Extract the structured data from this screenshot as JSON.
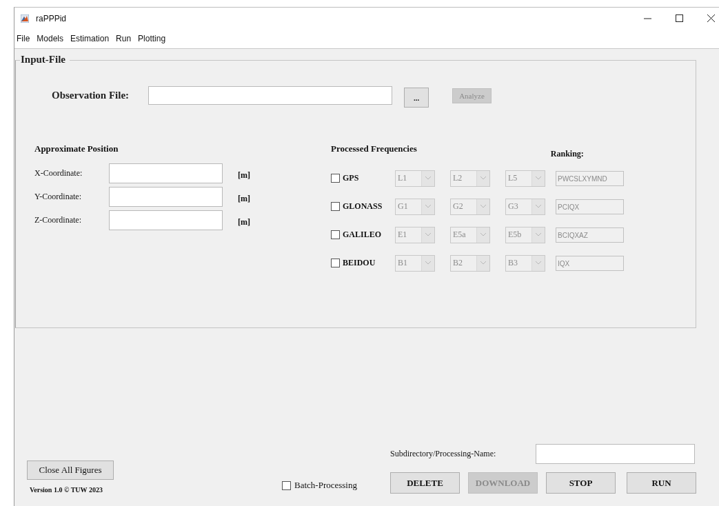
{
  "window": {
    "title": "raPPPid"
  },
  "menu": [
    "File",
    "Models",
    "Estimation",
    "Run",
    "Plotting"
  ],
  "input_panel": {
    "title": "Input-File",
    "observation_file": {
      "label": "Observation File:",
      "browse_button": {
        "label": "...",
        "disabled": false
      },
      "analyze_button": {
        "label": "Analyze",
        "disabled": true
      }
    },
    "approximate_position": {
      "title": "Approximate Position",
      "coordinates": [
        {
          "label": "X-Coordinate:",
          "unit": "[m]"
        },
        {
          "label": "Y-Coordinate:",
          "unit": "[m]"
        },
        {
          "label": "Z-Coordinate:",
          "unit": "[m]"
        }
      ]
    },
    "processed_frequencies": {
      "title": "Processed Frequencies",
      "ranking_label": "Ranking:",
      "systems": [
        {
          "name": "GPS",
          "checked": false,
          "disabled": true,
          "frequencies": [
            "L1",
            "L2",
            "L5"
          ],
          "ranking": "PWCSLXYMND"
        },
        {
          "name": "GLONASS",
          "checked": false,
          "disabled": true,
          "frequencies": [
            "G1",
            "G2",
            "G3"
          ],
          "ranking": "PCIQX"
        },
        {
          "name": "GALILEO",
          "checked": false,
          "disabled": true,
          "frequencies": [
            "E1",
            "E5a",
            "E5b"
          ],
          "ranking": "BCIQXAZ"
        },
        {
          "name": "BEIDOU",
          "checked": false,
          "disabled": true,
          "frequencies": [
            "B1",
            "B2",
            "B3"
          ],
          "ranking": "IQX"
        }
      ]
    }
  },
  "footer": {
    "close_all_button": {
      "label": "Close All Figures",
      "disabled": false
    },
    "version": "Version 1.0 © TUW 2023",
    "batch_processing": {
      "label": "Batch-Processing",
      "checked": false
    },
    "subdirectory_label": "Subdirectory/Processing-Name:",
    "buttons": [
      {
        "label": "DELETE",
        "disabled": false
      },
      {
        "label": "DOWNLOAD",
        "disabled": true
      },
      {
        "label": "STOP",
        "disabled": false
      },
      {
        "label": "RUN",
        "disabled": false
      }
    ]
  }
}
